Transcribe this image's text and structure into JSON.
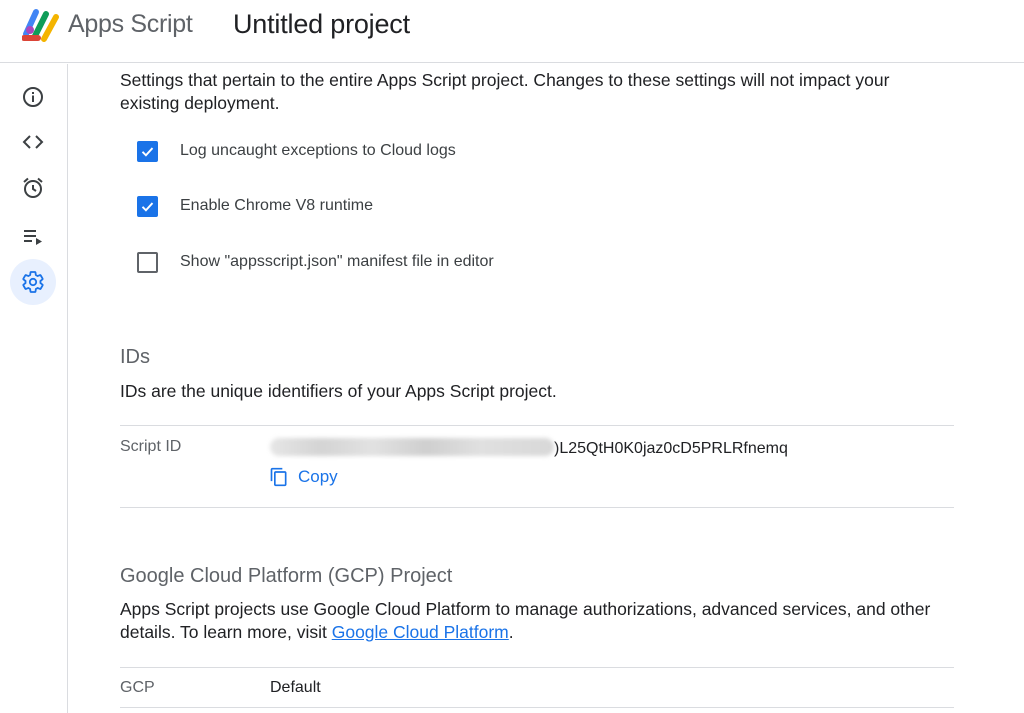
{
  "header": {
    "brand": "Apps Script",
    "project_title": "Untitled project"
  },
  "sidebar": {
    "items": [
      {
        "icon": "info-icon",
        "active": false
      },
      {
        "icon": "code-icon",
        "active": false
      },
      {
        "icon": "alarm-clock-icon",
        "active": false
      },
      {
        "icon": "executions-icon",
        "active": false
      },
      {
        "icon": "gear-icon",
        "active": true
      }
    ]
  },
  "general": {
    "description": "Settings that pertain to the entire Apps Script project. Changes to these settings will not impact your existing deployment.",
    "options": [
      {
        "label": "Log uncaught exceptions to Cloud logs",
        "checked": true
      },
      {
        "label": "Enable Chrome V8 runtime",
        "checked": true
      },
      {
        "label": "Show \"appsscript.json\" manifest file in editor",
        "checked": false
      }
    ]
  },
  "ids": {
    "title": "IDs",
    "description": "IDs are the unique identifiers of your Apps Script project.",
    "script_id_label": "Script ID",
    "script_id_visible": ")L25QtH0K0jaz0cD5PRLRfnemq",
    "copy_label": "Copy"
  },
  "gcp": {
    "title": "Google Cloud Platform (GCP) Project",
    "description_prefix": "Apps Script projects use Google Cloud Platform to manage authorizations, advanced services, and other details. To learn more, visit ",
    "link_text": "Google Cloud Platform",
    "description_suffix": ".",
    "field_label": "GCP",
    "field_value": "Default"
  },
  "colors": {
    "accent": "#1a73e8",
    "active_nav_bg": "#e8f0fe",
    "divider": "#dadce0"
  }
}
